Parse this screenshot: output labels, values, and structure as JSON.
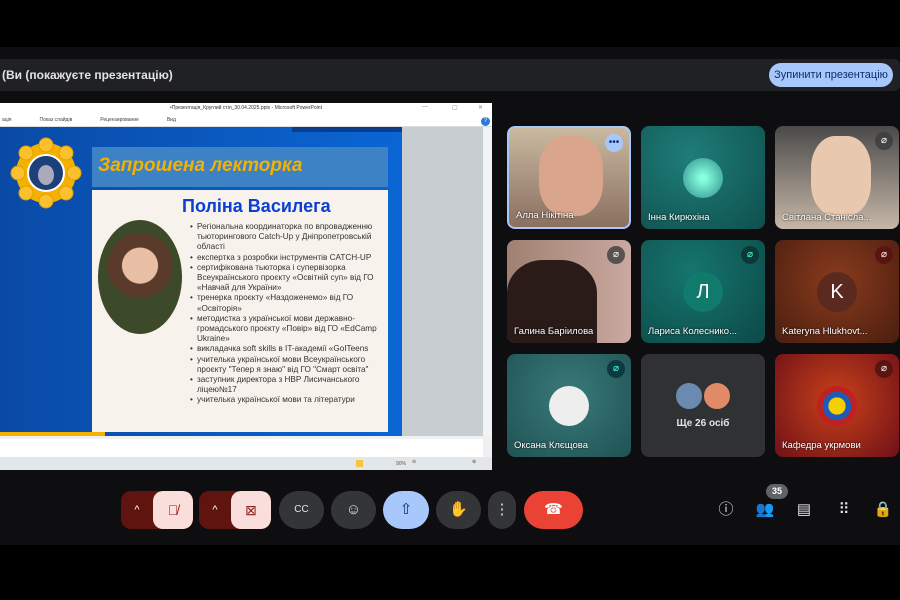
{
  "banner": {
    "text": "(Ви (покажуєте презентацію)",
    "stop_button": "Зупинити презентацію"
  },
  "ppt": {
    "window_title": "•Презентація_Круглий стіл_30.04.2025.pptx - Microsoft PowerPoint",
    "menu": [
      "ація",
      "Показ слайдів",
      "Рецензирование",
      "Вид"
    ],
    "zoom": "90%",
    "slide": {
      "heading": "Запрошена лекторка",
      "name": "Поліна Василега",
      "bullets": [
        "Регіональна координаторка по впровадженню тьюторингового Catch-Up у Дніпропетровській області",
        "експертка з розробки інструментів CATCH-UP",
        "сертифікована тьюторка і супервізорка Всеукраїнського проєкту «Освітній суп» від ГО «Навчай для України»",
        "тренерка проєкту «Наздоженемо» від ГО «Освіторія»",
        "методистка з української мови державно-громадського проєкту «Повір» від ГО «EdCamp Ukraine»",
        "викладачка soft skills в IT-академії «GoITeens",
        "учителька української мови Всеукраїнського проєкту \"Тепер я знаю\" від ГО \"Смарт освіта\"",
        "заступник директора з НВР Лисичанського ліцею№17",
        "учителька української мови та літератури"
      ]
    }
  },
  "participants": [
    {
      "name": "Алла Нікітіна",
      "muted": false
    },
    {
      "name": "Інна Кирюхіна",
      "muted": false
    },
    {
      "name": "Світлана Станісла...",
      "muted": true
    },
    {
      "name": "Галина Баріилова",
      "muted": true
    },
    {
      "name": "Лариса Колеснико...",
      "initial": "Л",
      "muted": true
    },
    {
      "name": "Kateryna Hlukhovt...",
      "initial": "K",
      "muted": true
    },
    {
      "name": "Оксана Клєщова",
      "muted": true
    },
    {
      "name": "Ще 26 осіб"
    },
    {
      "name": "Кафедра укрмови",
      "muted": true
    }
  ],
  "toolbar": {
    "participants_count": "35"
  },
  "colors": {
    "accent": "#a8c7fa",
    "end_call": "#ea4335",
    "muted_red": "#601410"
  }
}
